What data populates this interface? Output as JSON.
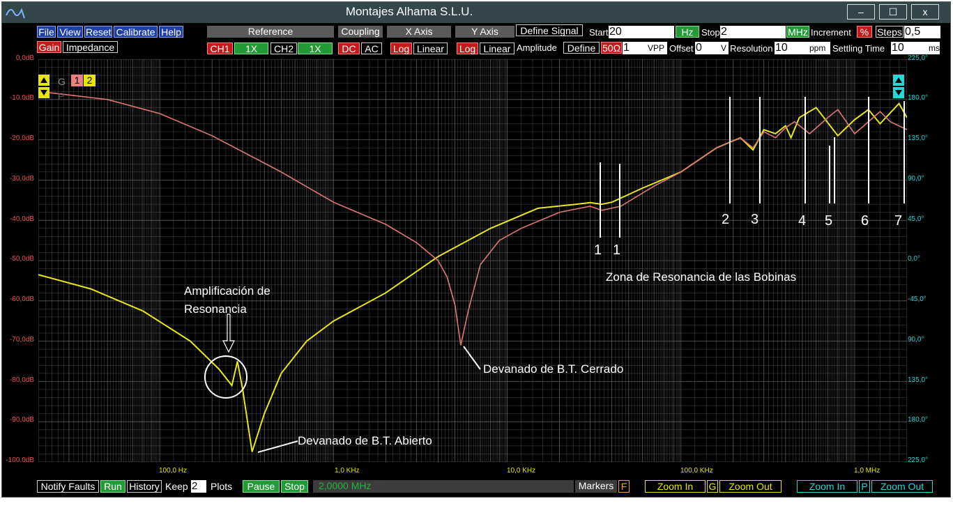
{
  "window": {
    "title": "Montajes Alhama S.L.U.",
    "min": "–",
    "max": "☐",
    "close": "x"
  },
  "menu": {
    "file": "File",
    "view": "View",
    "reset": "Reset",
    "calibrate": "Calibrate",
    "help": "Help",
    "gain": "Gain",
    "impedance": "Impedance"
  },
  "reference": {
    "label": "Reference",
    "ch1": "CH1",
    "ch1_scale": "1X",
    "ch2": "CH2",
    "ch2_scale": "1X"
  },
  "coupling": {
    "label": "Coupling",
    "dc": "DC",
    "ac": "AC"
  },
  "x_axis": {
    "label": "X Axis",
    "log": "Log",
    "linear": "Linear"
  },
  "y_axis": {
    "label": "Y Axis",
    "log": "Log",
    "linear": "Linear"
  },
  "signal": {
    "define_signal": "Define Signal",
    "start_label": "Start",
    "start_value": "20",
    "start_unit": "Hz",
    "stop_label": "Stop",
    "stop_value": "2",
    "stop_unit": "MHz",
    "increment_label": "Increment",
    "increment_mode": "%",
    "steps_label": "Steps",
    "steps_value": "0,5",
    "amplitude_label": "Amplitude",
    "define": "Define",
    "impedance": "50Ω",
    "amplitude_value": "1",
    "amplitude_unit": "VPP",
    "offset_label": "Offset",
    "offset_value": "0",
    "offset_unit": "V",
    "resolution_label": "Resolution",
    "resolution_value": "10",
    "resolution_unit": "ppm",
    "settling_label": "Settling Time",
    "settling_value": "10",
    "settling_unit": "ms"
  },
  "plot": {
    "channel_g": "G",
    "channel_p": "P",
    "channel_1": "1",
    "channel_2": "2",
    "gain_ticks": [
      "0,0dB",
      "-10,0dB",
      "-20,0dB",
      "-30,0dB",
      "-40,0dB",
      "-50,0dB",
      "-60,0dB",
      "-70,0dB",
      "-80,0dB",
      "-90,0dB",
      "-100,0dB"
    ],
    "phase_ticks": [
      "225,0°",
      "180,0°",
      "135,0°",
      "90,0°",
      "45,0°",
      "0,0°",
      "-45,0°",
      "90,0°",
      "135,0°",
      "180,0°",
      "225,0°"
    ],
    "freq_ticks": [
      "100,0 Hz",
      "1,0 KHz",
      "10,0 KHz",
      "100,0 KHz",
      "1,0 MHz"
    ],
    "colors": {
      "trace_yellow": "#e8e81a",
      "trace_pink": "#e07878",
      "grid": "#5c5c5c",
      "gain_axis": "#f05050",
      "phase_axis": "#22d8d8"
    }
  },
  "annotations": {
    "amplification": "Amplificación de",
    "resonance": "Resonancia",
    "closed": "Devanado de B.T. Cerrado",
    "open": "Devanado de B.T. Abierto",
    "zone": "Zona de Resonancia de las Bobinas",
    "markers": [
      "1",
      "1",
      "2",
      "3",
      "4",
      "5",
      "6",
      "7"
    ]
  },
  "chart_data": {
    "type": "line",
    "x_scale": "log",
    "xlim_hz": [
      20,
      2000000
    ],
    "ylim_db": [
      -100,
      0
    ],
    "y2lim_deg": [
      -225,
      225
    ],
    "series": [
      {
        "color": "#e8e81a",
        "x": [
          20,
          40,
          80,
          150,
          220,
          260,
          280,
          300,
          340,
          400,
          500,
          700,
          1000,
          2000,
          4000,
          8000,
          15000,
          25000,
          30000,
          35000,
          40000,
          60000,
          100000,
          160000,
          220000,
          260000,
          300000,
          350000,
          400000,
          430000,
          480000,
          600000,
          800000,
          1000000,
          1200000,
          1400000,
          1800000,
          2000000
        ],
        "y": [
          -53.5,
          -57,
          -62.5,
          -70,
          -77,
          -81,
          -75,
          -82,
          -97.5,
          -88,
          -78,
          -70,
          -65,
          -58,
          -49,
          -42,
          -37,
          -36,
          -35.6,
          -36,
          -35.5,
          -32,
          -28,
          -22,
          -19.5,
          -22.5,
          -17.5,
          -18.5,
          -16.5,
          -19.5,
          -14.5,
          -12,
          -19,
          -15,
          -12.5,
          -16,
          -11,
          -14.5
        ]
      },
      {
        "color": "#e07878",
        "x": [
          20,
          50,
          100,
          200,
          500,
          1000,
          2000,
          3000,
          4000,
          4500,
          5000,
          5400,
          6000,
          7000,
          9000,
          12000,
          20000,
          30000,
          35000,
          45000,
          70000,
          100000,
          160000,
          220000,
          260000,
          300000,
          350000,
          400000,
          450000,
          550000,
          700000,
          800000,
          1000000,
          1200000,
          1400000,
          1600000,
          2000000
        ],
        "y": [
          -8,
          -10,
          -13.5,
          -19,
          -28,
          -35.5,
          -41,
          -45.5,
          -50,
          -54,
          -61,
          -71,
          -62,
          -51,
          -45,
          -42,
          -38,
          -36.5,
          -37.5,
          -36.5,
          -31.5,
          -28,
          -22,
          -19.5,
          -22,
          -18,
          -19.5,
          -17,
          -15.5,
          -18.5,
          -14.5,
          -12.5,
          -18.5,
          -15.5,
          -13,
          -15.5,
          -17.5
        ]
      }
    ]
  },
  "bottom": {
    "notify_faults": "Notify Faults",
    "run": "Run",
    "history": "History",
    "keep": "Keep",
    "keep_value": "2",
    "plots": "Plots",
    "pause": "Pause",
    "stop": "Stop",
    "status": "2,0000 MHz",
    "markers": "Markers",
    "markers_key": "F",
    "zoom_in_g": "Zoom In",
    "g": "G",
    "zoom_out_g": "Zoom Out",
    "zoom_in_p": "Zoom In",
    "p": "P",
    "zoom_out_p": "Zoom Out"
  }
}
